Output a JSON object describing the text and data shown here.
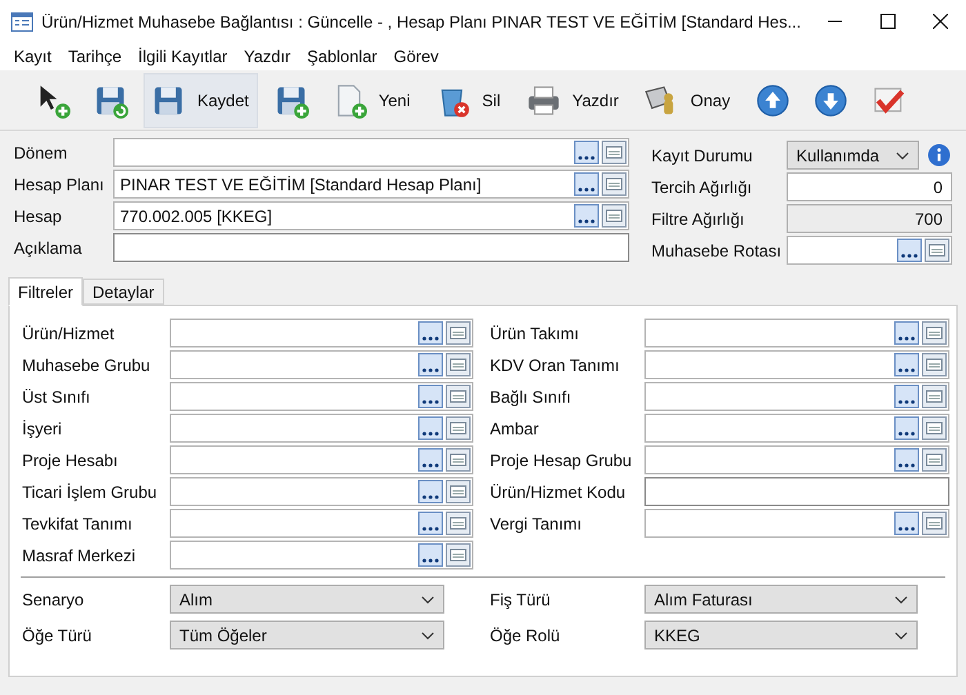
{
  "window": {
    "title": "Ürün/Hizmet Muhasebe Bağlantısı : Güncelle - , Hesap Planı PINAR TEST VE EĞİTİM [Standard Hes..."
  },
  "menu": [
    "Kayıt",
    "Tarihçe",
    "İlgili Kayıtlar",
    "Yazdır",
    "Şablonlar",
    "Görev"
  ],
  "toolbar": [
    {
      "kind": "add",
      "hovered": false
    },
    {
      "kind": "save-refresh",
      "hovered": false
    },
    {
      "kind": "save",
      "label": "Kaydet",
      "hovered": true
    },
    {
      "kind": "save-add",
      "hovered": false
    },
    {
      "kind": "new",
      "label": "Yeni",
      "hovered": false
    },
    {
      "kind": "delete",
      "label": "Sil",
      "hovered": false
    },
    {
      "kind": "print",
      "label": "Yazdır",
      "hovered": false
    },
    {
      "kind": "approve",
      "label": "Onay",
      "hovered": false
    },
    {
      "kind": "up",
      "hovered": false
    },
    {
      "kind": "down",
      "hovered": false
    },
    {
      "kind": "check",
      "hovered": false
    }
  ],
  "header_left": [
    {
      "kind": "lookup",
      "label": "Dönem"
    },
    {
      "kind": "lookup",
      "label": "Hesap Planı",
      "value": "PINAR TEST VE EĞİTİM [Standard Hesap Planı]"
    },
    {
      "kind": "lookup",
      "label": "Hesap",
      "value": "770.002.005 [KKEG]"
    },
    {
      "kind": "text",
      "label": "Açıklama"
    }
  ],
  "header_right": [
    {
      "kind": "select",
      "label": "Kayıt Durumu",
      "value": "Kullanımda",
      "info": true
    },
    {
      "kind": "number",
      "label": "Tercih Ağırlığı",
      "value": "0",
      "readonly": false
    },
    {
      "kind": "number",
      "label": "Filtre Ağırlığı",
      "value": "700",
      "readonly": true
    },
    {
      "kind": "lookup",
      "label": "Muhasebe Rotası"
    }
  ],
  "tabs": [
    {
      "label": "Filtreler",
      "selected": true
    },
    {
      "label": "Detaylar",
      "selected": false
    }
  ],
  "filters_left": [
    {
      "kind": "lookup",
      "label": "Ürün/Hizmet"
    },
    {
      "kind": "lookup",
      "label": "Muhasebe Grubu"
    },
    {
      "kind": "lookup",
      "label": "Üst Sınıfı"
    },
    {
      "kind": "lookup",
      "label": "İşyeri"
    },
    {
      "kind": "lookup",
      "label": "Proje Hesabı"
    },
    {
      "kind": "lookup",
      "label": "Ticari İşlem Grubu"
    },
    {
      "kind": "lookup",
      "label": "Tevkifat Tanımı"
    },
    {
      "kind": "lookup",
      "label": "Masraf Merkezi"
    }
  ],
  "filters_right": [
    {
      "kind": "lookup",
      "label": "Ürün Takımı"
    },
    {
      "kind": "lookup",
      "label": "KDV Oran Tanımı"
    },
    {
      "kind": "lookup",
      "label": "Bağlı Sınıfı"
    },
    {
      "kind": "lookup",
      "label": "Ambar"
    },
    {
      "kind": "lookup",
      "label": "Proje Hesap Grubu"
    },
    {
      "kind": "text",
      "label": "Ürün/Hizmet Kodu"
    },
    {
      "kind": "lookup",
      "label": "Vergi Tanımı"
    }
  ],
  "options_left": [
    {
      "kind": "select",
      "label": "Senaryo",
      "value": "Alım"
    },
    {
      "kind": "select",
      "label": "Öğe Türü",
      "value": "Tüm Öğeler"
    }
  ],
  "options_right": [
    {
      "kind": "select",
      "label": "Fiş Türü",
      "value": "Alım Faturası"
    },
    {
      "kind": "select",
      "label": "Öğe Rolü",
      "value": "KKEG"
    }
  ]
}
